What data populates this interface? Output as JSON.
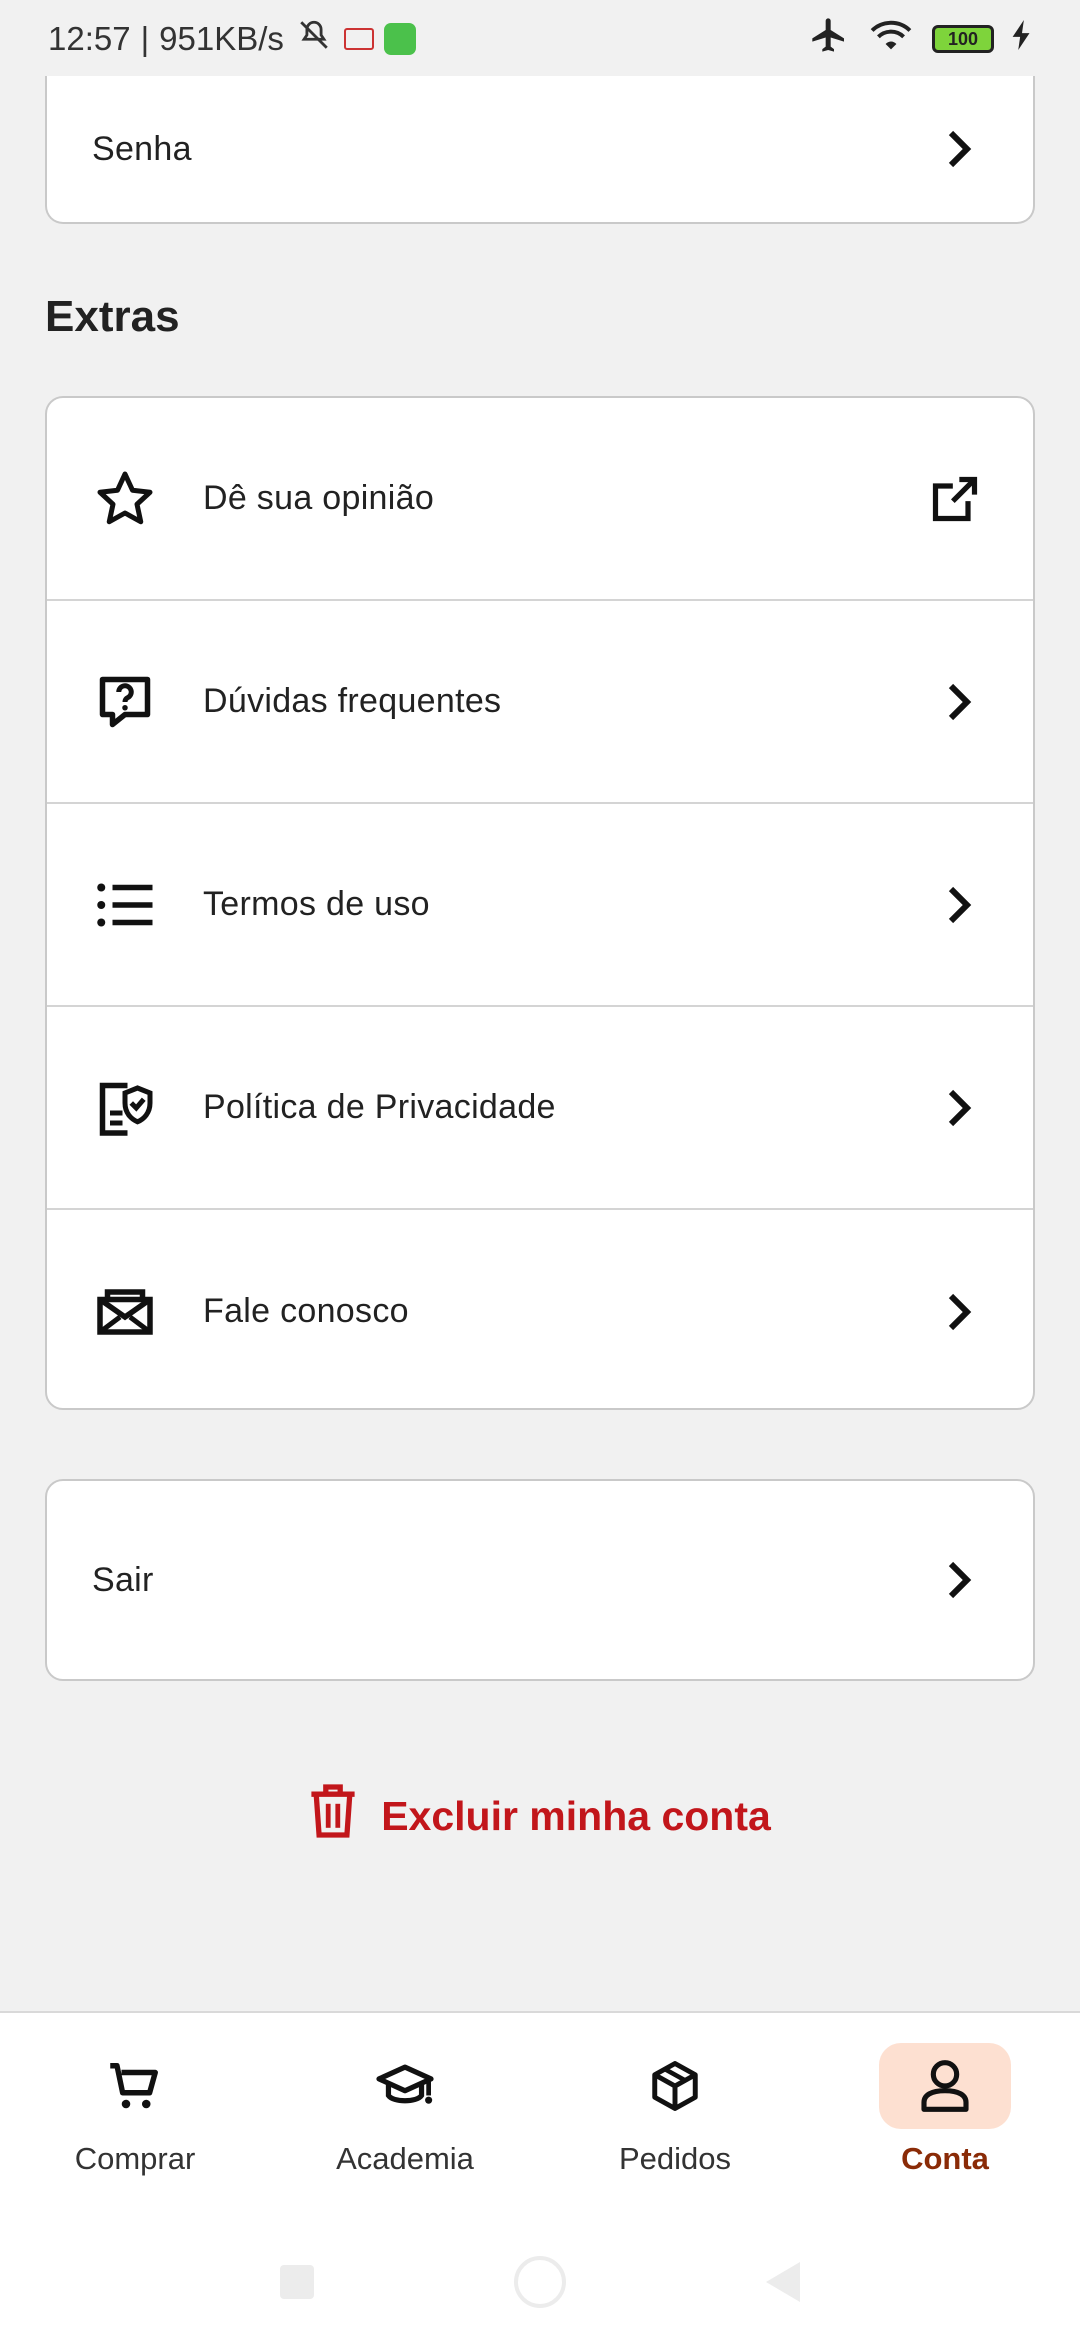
{
  "status_bar": {
    "time": "12:57",
    "network_speed": "951KB/s",
    "battery_level": "100",
    "icons": [
      "mute-icon",
      "gmail-icon",
      "app-icon",
      "airplane-icon",
      "wifi-icon",
      "battery-icon",
      "charging-icon"
    ]
  },
  "account_card": {
    "password_label": "Senha"
  },
  "extras": {
    "title": "Extras",
    "items": [
      {
        "label": "Dê sua opinião",
        "icon": "star-icon",
        "trailing": "external-link-icon"
      },
      {
        "label": "Dúvidas frequentes",
        "icon": "question-chat-icon",
        "trailing": "chevron-right-icon"
      },
      {
        "label": "Termos de uso",
        "icon": "list-icon",
        "trailing": "chevron-right-icon"
      },
      {
        "label": "Política de Privacidade",
        "icon": "shield-document-icon",
        "trailing": "chevron-right-icon"
      },
      {
        "label": "Fale conosco",
        "icon": "mail-icon",
        "trailing": "chevron-right-icon"
      }
    ]
  },
  "logout": {
    "label": "Sair"
  },
  "delete_account": {
    "label": "Excluir minha conta",
    "color": "#c2161b"
  },
  "bottom_nav": {
    "items": [
      {
        "label": "Comprar",
        "icon": "cart-icon",
        "active": false
      },
      {
        "label": "Academia",
        "icon": "graduation-cap-icon",
        "active": false
      },
      {
        "label": "Pedidos",
        "icon": "box-icon",
        "active": false
      },
      {
        "label": "Conta",
        "icon": "user-icon",
        "active": true
      }
    ],
    "active_color": "#8a2b07",
    "active_bg": "#fde0d1"
  }
}
